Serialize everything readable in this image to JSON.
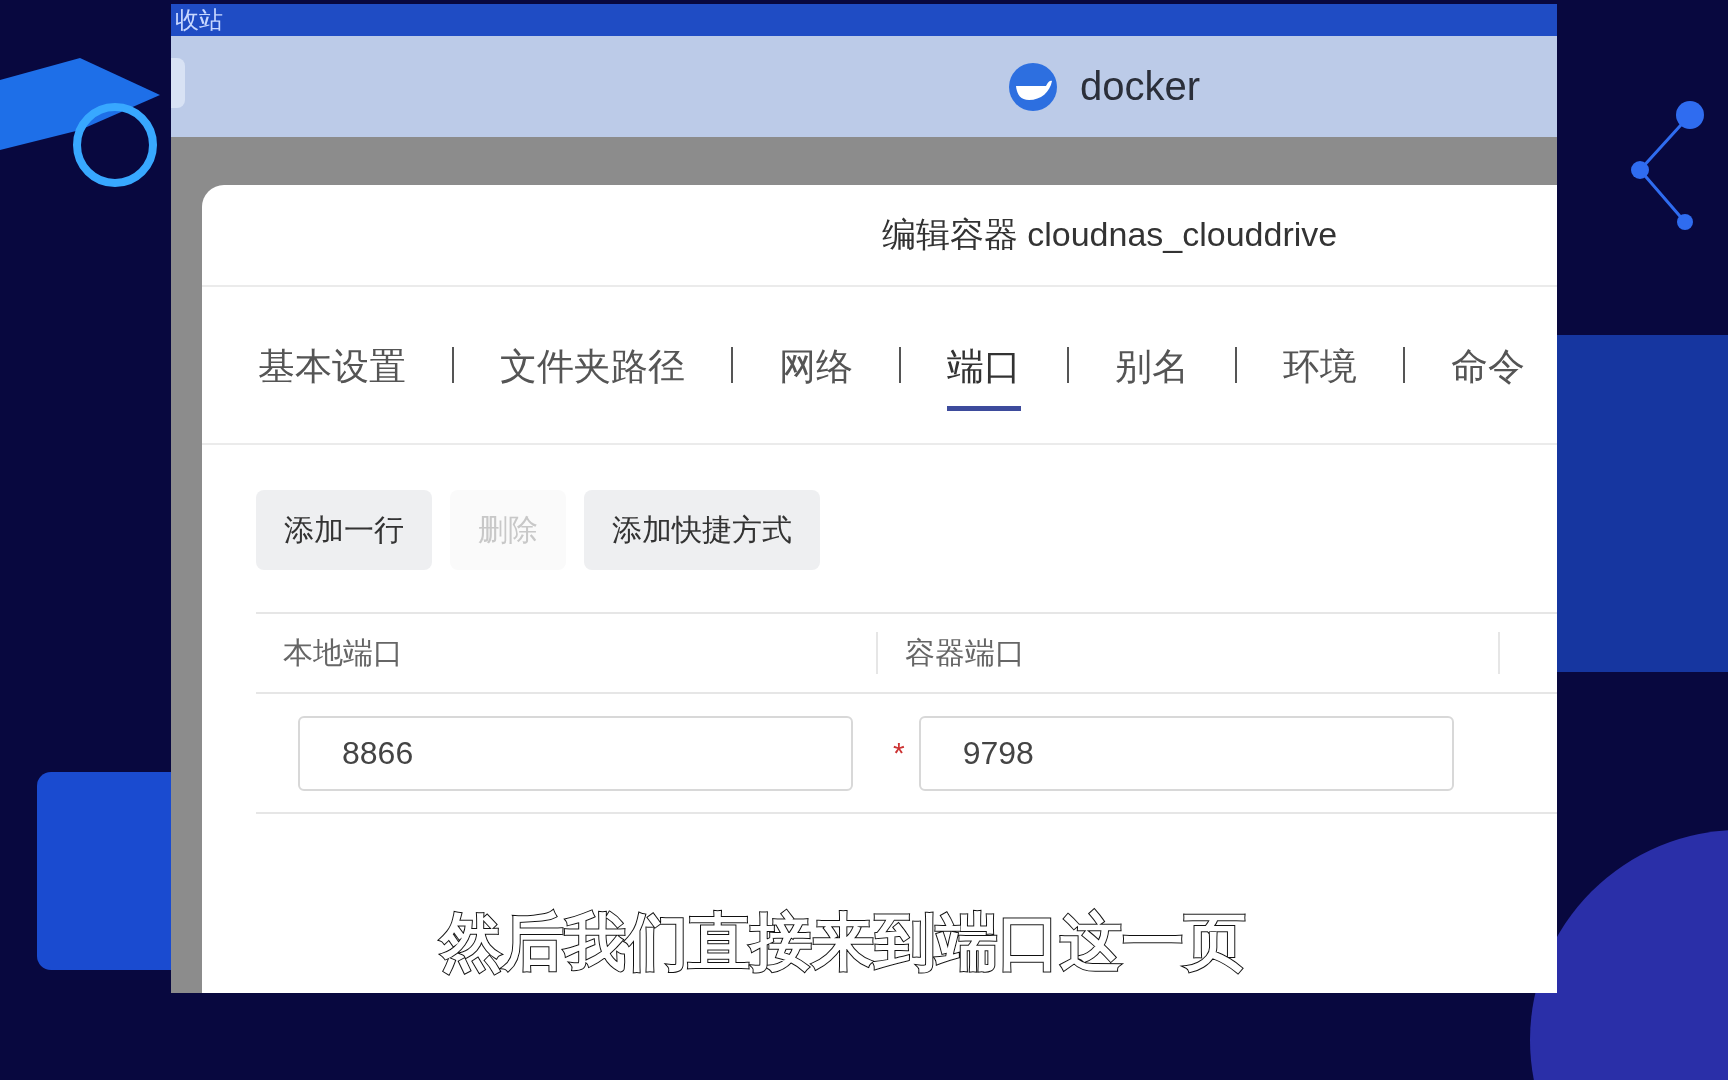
{
  "top_bar": {
    "text": "收站"
  },
  "header": {
    "title": "docker"
  },
  "dialog": {
    "title": "编辑容器 cloudnas_clouddrive",
    "tabs": [
      {
        "label": "基本设置",
        "selected": false
      },
      {
        "label": "文件夹路径",
        "selected": false
      },
      {
        "label": "网络",
        "selected": false
      },
      {
        "label": "端口",
        "selected": true
      },
      {
        "label": "别名",
        "selected": false
      },
      {
        "label": "环境",
        "selected": false
      },
      {
        "label": "命令",
        "selected": false
      }
    ],
    "buttons": [
      {
        "label": "添加一行",
        "disabled": false
      },
      {
        "label": "删除",
        "disabled": true
      },
      {
        "label": "添加快捷方式",
        "disabled": false
      }
    ],
    "table": {
      "columns": [
        "本地端口",
        "容器端口"
      ],
      "rows": [
        {
          "local_port": "8866",
          "required_mark": "*",
          "container_port": "9798"
        }
      ]
    }
  },
  "subtitle": "然后我们直接来到端口这一页"
}
